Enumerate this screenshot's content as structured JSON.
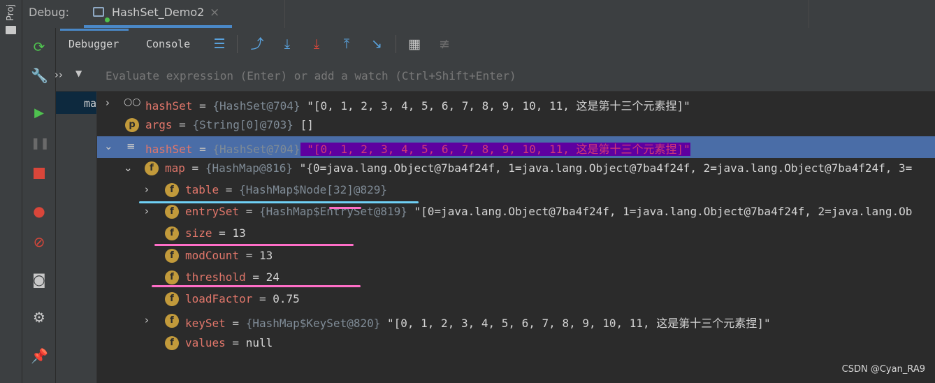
{
  "window": {
    "debug_label": "Debug:",
    "run_tab": "HashSet_Demo2",
    "project_strip_label": "Proj"
  },
  "toolbar": {
    "tabs": [
      "Debugger",
      "Console"
    ]
  },
  "evaluate": {
    "placeholder": "Evaluate expression (Enter) or add a watch (Ctrl+Shift+Enter)"
  },
  "frames": {
    "current": "ma"
  },
  "variables": [
    {
      "name": "hashSet",
      "eq": " = ",
      "type": "{HashSet@704}",
      "value": " \"[0, 1, 2, 3, 4, 5, 6, 7, 8, 9, 10, 11, 这是第十三个元素捏]\""
    },
    {
      "name": "args",
      "eq": " = ",
      "type": "{String[0]@703}",
      "value": " []"
    },
    {
      "name": "hashSet",
      "eq": " = ",
      "type": "{HashSet@704}",
      "value": " \"[0, 1, 2, 3, 4, 5, 6, 7, 8, 9, 10, 11, 这是第十三个元素捏]\""
    },
    {
      "name": "map",
      "eq": " = ",
      "type": "{HashMap@816}",
      "value": " \"{0=java.lang.Object@7ba4f24f, 1=java.lang.Object@7ba4f24f, 2=java.lang.Object@7ba4f24f, 3="
    },
    {
      "name": "table",
      "eq": " = ",
      "type": "{HashMap$Node[32]@829}",
      "value": ""
    },
    {
      "name": "entrySet",
      "eq": " = ",
      "type": "{HashMap$EntrySet@819}",
      "value": " \"[0=java.lang.Object@7ba4f24f, 1=java.lang.Object@7ba4f24f, 2=java.lang.Ob"
    },
    {
      "name": "size",
      "eq": " = ",
      "type": "",
      "value": "13"
    },
    {
      "name": "modCount",
      "eq": " = ",
      "type": "",
      "value": "13"
    },
    {
      "name": "threshold",
      "eq": " = ",
      "type": "",
      "value": "24"
    },
    {
      "name": "loadFactor",
      "eq": " = ",
      "type": "",
      "value": "0.75"
    },
    {
      "name": "keySet",
      "eq": " = ",
      "type": "{HashMap$KeySet@820}",
      "value": " \"[0, 1, 2, 3, 4, 5, 6, 7, 8, 9, 10, 11, 这是第十三个元素捏]\""
    },
    {
      "name": "values",
      "eq": " = ",
      "type": "",
      "value": "null"
    }
  ],
  "badges": {
    "field": "f",
    "param": "p"
  },
  "annotation_colors": {
    "cyan": "#6fd0f5",
    "pink": "#ff6ec7"
  },
  "watermark": "CSDN @Cyan_RA9"
}
